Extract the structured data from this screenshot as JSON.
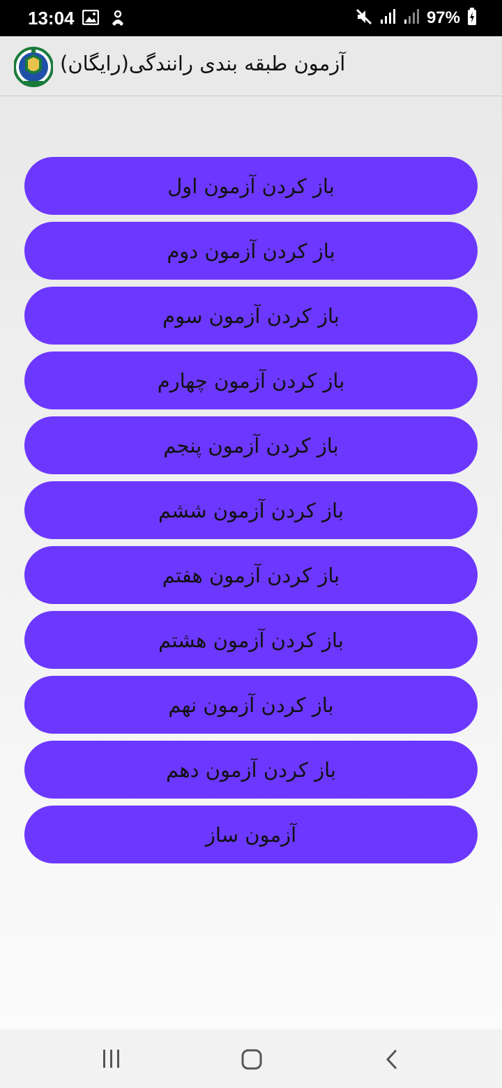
{
  "status_bar": {
    "time": "13:04",
    "battery": "97%",
    "icons": [
      "image-icon",
      "notification-icon",
      "mute-icon",
      "signal-icon",
      "signal-icon",
      "battery-icon"
    ]
  },
  "app_bar": {
    "title": "آزمون طبقه بندی رانندگی(رایگان)",
    "logo_icon": "police-logo-icon"
  },
  "buttons": [
    "باز کردن آزمون اول",
    "باز کردن آزمون دوم",
    "باز کردن آزمون سوم",
    "باز کردن آزمون چهارم",
    "باز کردن آزمون پنجم",
    "باز کردن آزمون ششم",
    "باز کردن آزمون هفتم",
    "باز کردن آزمون هشتم",
    "باز کردن آزمون نهم",
    "باز کردن آزمون دهم",
    "آزمون ساز"
  ],
  "colors": {
    "button_bg": "#6c38ff",
    "button_text": "#111111",
    "app_bar_bg": "#e9e9e9",
    "status_bar_bg": "#000000"
  },
  "nav_bar": {
    "icons": [
      "recent-apps-icon",
      "home-icon",
      "back-icon"
    ]
  }
}
